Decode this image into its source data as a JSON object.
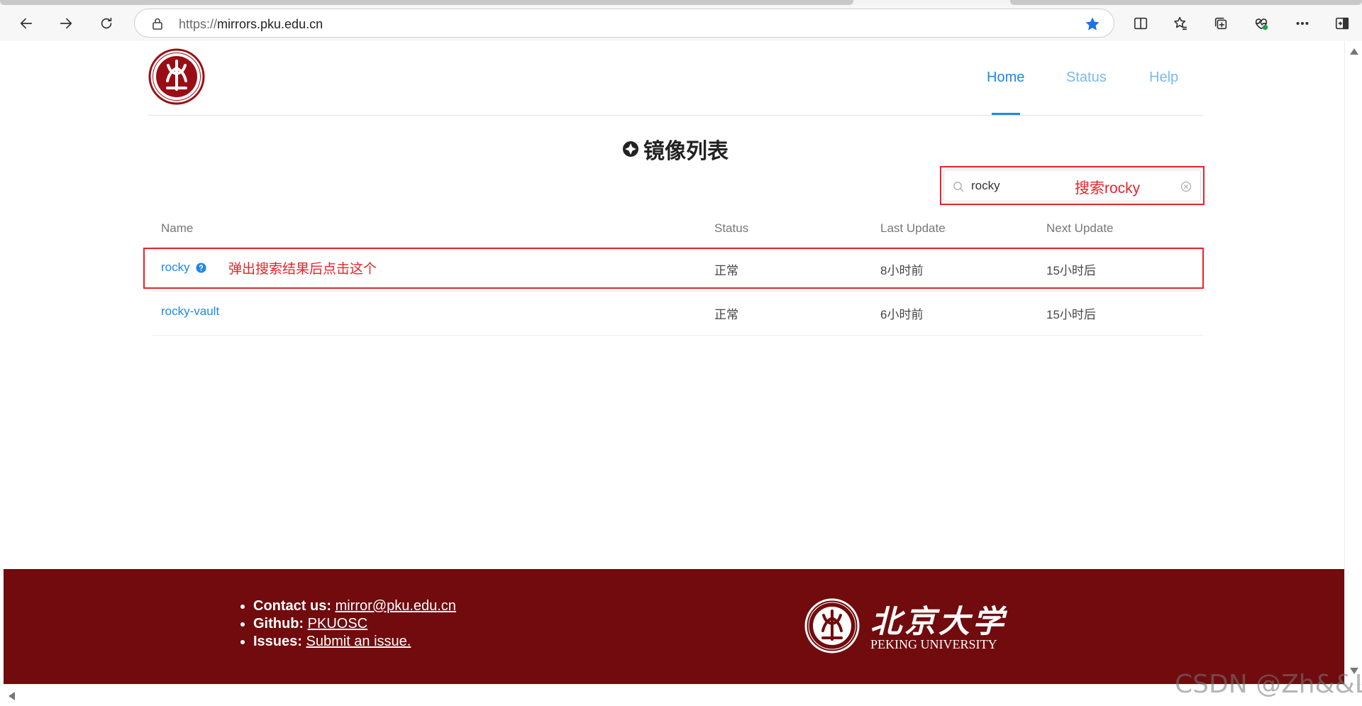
{
  "browser": {
    "url_scheme": "https://",
    "url_host": "mirrors.pku.edu.cn",
    "icons": [
      "back-icon",
      "forward-icon",
      "refresh-icon",
      "lock-icon",
      "star-icon",
      "split-screen-icon",
      "favorites-icon",
      "collections-icon",
      "health-icon",
      "more-icon",
      "sidebar-icon"
    ]
  },
  "header": {
    "nav": [
      {
        "label": "Home"
      },
      {
        "label": "Status"
      },
      {
        "label": "Help"
      }
    ]
  },
  "page": {
    "title": "镜像列表"
  },
  "search": {
    "value": "rocky",
    "annotation": "搜索rocky"
  },
  "table": {
    "columns": [
      "Name",
      "Status",
      "Last Update",
      "Next Update"
    ],
    "rows": [
      {
        "name": "rocky",
        "status": "正常",
        "last_update": "8小时前",
        "next_update": "15小时后"
      },
      {
        "name": "rocky-vault",
        "status": "正常",
        "last_update": "6小时前",
        "next_update": "15小时后"
      }
    ],
    "row_annotation": "弹出搜索结果后点击这个"
  },
  "footer": {
    "contact_label": "Contact us:",
    "contact_value": "mirror@pku.edu.cn",
    "github_label": "Github:",
    "github_value": "PKUOSC",
    "issues_label": "Issues:",
    "issues_value": "Submit an issue.",
    "university_cn": "北京大学",
    "university_en": "PEKING UNIVERSITY"
  },
  "watermark": "CSDN @Zh&&Li",
  "colors": {
    "accent": "#1e88e5",
    "footer_bg": "#710b0d",
    "annotation_red": "#e8232b"
  }
}
